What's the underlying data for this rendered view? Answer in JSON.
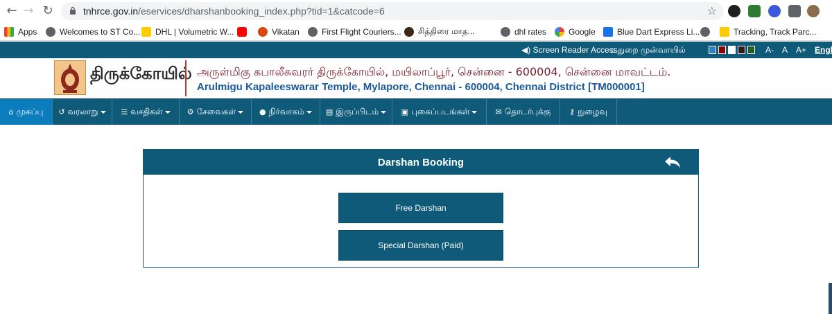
{
  "browser": {
    "url_host": "tnhrce.gov.in",
    "url_path": "/eservices/dharshanbooking_index.php?tid=1&catcode=6"
  },
  "bookmarks": [
    {
      "label": "Apps",
      "color": "#ea4335"
    },
    {
      "label": "Welcomes to ST Co...",
      "color": "#5f6368"
    },
    {
      "label": "DHL | Volumetric W...",
      "color": "#ffcc00"
    },
    {
      "label": "",
      "color": "#ff0000"
    },
    {
      "label": "Vikatan",
      "color": "#d9480f"
    },
    {
      "label": "First Flight Couriers...",
      "color": "#5f6368"
    },
    {
      "label": "சித்திரை மாத...",
      "color": "#3b2a1a"
    },
    {
      "label": "dhl rates",
      "color": "#5f6368"
    },
    {
      "label": "Google",
      "color": "#4285f4"
    },
    {
      "label": "Blue Dart Express Li...",
      "color": "#1a73e8"
    },
    {
      "label": "",
      "color": "#5f6368"
    },
    {
      "label": "Tracking, Track Parc...",
      "color": "#ffcc00"
    }
  ],
  "utility": {
    "screen_reader": "Screen Reader Access",
    "home": "துறை முன்வாயில்",
    "font_small": "A-",
    "font_normal": "A",
    "font_large": "A+",
    "language": "Engl",
    "swatches": [
      "#2f7fc1",
      "#8b0000",
      "#ffffff",
      "#2b1a1a",
      "#1f5f1f"
    ]
  },
  "header": {
    "logo_text": "திருக்கோயில்",
    "title_ta": "அருள்மிகு கபாலீசுவரர் திருக்கோயில், மயிலாப்பூர், சென்னை - 600004, சென்னை மாவட்டம்.",
    "title_en": "Arulmigu Kapaleeswarar Temple, Mylapore, Chennai - 600004, Chennai District [TM000001]"
  },
  "nav": {
    "items": [
      {
        "label": "முகப்பு",
        "icon": "home-icon",
        "caret": false
      },
      {
        "label": "வரலாறு",
        "icon": "history-icon",
        "caret": true
      },
      {
        "label": "வசதிகள்",
        "icon": "list-icon",
        "caret": true
      },
      {
        "label": "சேவைகள்",
        "icon": "cogs-icon",
        "caret": true
      },
      {
        "label": "நிர்வாகம்",
        "icon": "user-icon",
        "caret": true
      },
      {
        "label": "இருப்பிடம்",
        "icon": "map-icon",
        "caret": true
      },
      {
        "label": "புகைப்படங்கள்",
        "icon": "image-icon",
        "caret": true
      },
      {
        "label": "தொடர்புக்கு",
        "icon": "envelope-icon",
        "caret": false
      },
      {
        "label": "நுழைவு",
        "icon": "key-icon",
        "caret": false
      }
    ]
  },
  "panel": {
    "title": "Darshan Booking",
    "free_label": "Free Darshan",
    "special_label": "Special Darshan (Paid)"
  },
  "colors": {
    "primary": "#0f5a78",
    "active_nav": "#0b7cbc"
  }
}
